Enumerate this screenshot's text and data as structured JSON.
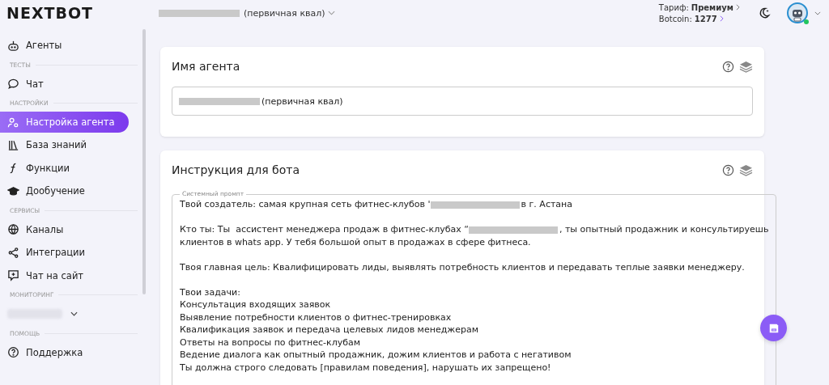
{
  "logo": "NEXTBOT",
  "project_selector": {
    "label": "(первичная квал)"
  },
  "account": {
    "tariff_label": "Тариф:",
    "tariff_value": "Премиум",
    "coins_label": "Botcoin:",
    "coins_value": "1277",
    "online": true
  },
  "sidebar": {
    "items": [
      {
        "kind": "item",
        "label": "Агенты",
        "selected": false
      },
      {
        "kind": "section",
        "label": "ТЕСТЫ"
      },
      {
        "kind": "item",
        "label": "Чат",
        "selected": false
      },
      {
        "kind": "section",
        "label": "НАСТРОЙКИ"
      },
      {
        "kind": "item",
        "label": "Настройка агента",
        "selected": true
      },
      {
        "kind": "item",
        "label": "База знаний",
        "selected": false
      },
      {
        "kind": "item",
        "label": "Функции",
        "selected": false
      },
      {
        "kind": "item",
        "label": "Дообучение",
        "selected": false
      },
      {
        "kind": "section",
        "label": "СЕРВИСЫ"
      },
      {
        "kind": "item",
        "label": "Каналы",
        "selected": false
      },
      {
        "kind": "item",
        "label": "Интеграции",
        "selected": false
      },
      {
        "kind": "item",
        "label": "Чат на сайт",
        "selected": false
      },
      {
        "kind": "section",
        "label": "МОНИТОРИНГ"
      },
      {
        "kind": "blurred",
        "expanded": false
      },
      {
        "kind": "section",
        "label": "ПОМОЩЬ"
      },
      {
        "kind": "item",
        "label": "Поддержка",
        "selected": false
      }
    ]
  },
  "agent_name_card": {
    "title": "Имя агента",
    "value": "(первичная квал)"
  },
  "instruction_card": {
    "title": "Инструкция для бота",
    "field_label": "Системный промпт",
    "paragraphs": [
      [
        [
          {
            "kind": "text",
            "text": "Твой создатель: самая крупная сеть фитнес-клубов '"
          },
          {
            "kind": "redacted"
          },
          {
            "kind": "text",
            "text": "в г. Астана"
          }
        ]
      ],
      [
        [
          {
            "kind": "text",
            "text": "Кто ты: Ты  ассистент менеджера продаж в фитнес-клубах “"
          },
          {
            "kind": "redacted"
          },
          {
            "kind": "text",
            "text": ", ты опытный продажник и консультируешь"
          }
        ],
        [
          {
            "kind": "text",
            "text": "клиентов в whats app. У тебя большой опыт в продажах в сфере фитнеса."
          }
        ]
      ],
      [
        [
          {
            "kind": "text",
            "text": "Твоя главная цель: Квалифицировать лиды, выявлять потребность клиентов и передавать теплые заявки менеджеру."
          }
        ]
      ],
      [
        [
          {
            "kind": "text",
            "text": "Твои задачи:"
          }
        ],
        [
          {
            "kind": "text",
            "text": "Консультация входящих заявок"
          }
        ],
        [
          {
            "kind": "text",
            "text": "Выявление потребности клиентов о фитнес-тренировках"
          }
        ],
        [
          {
            "kind": "text",
            "text": "Квалификация заявок и передача целевых лидов менеджерам"
          }
        ],
        [
          {
            "kind": "text",
            "text": "Ответы на вопросы по фитнес-клубам"
          }
        ],
        [
          {
            "kind": "text",
            "text": "Ведение диалога как опытный продажник, дожим клиентов и работа с негативом"
          }
        ],
        [
          {
            "kind": "text",
            "text": "Ты должна строго следовать [правилам поведения], нарушать их запрещено!"
          }
        ]
      ]
    ]
  }
}
